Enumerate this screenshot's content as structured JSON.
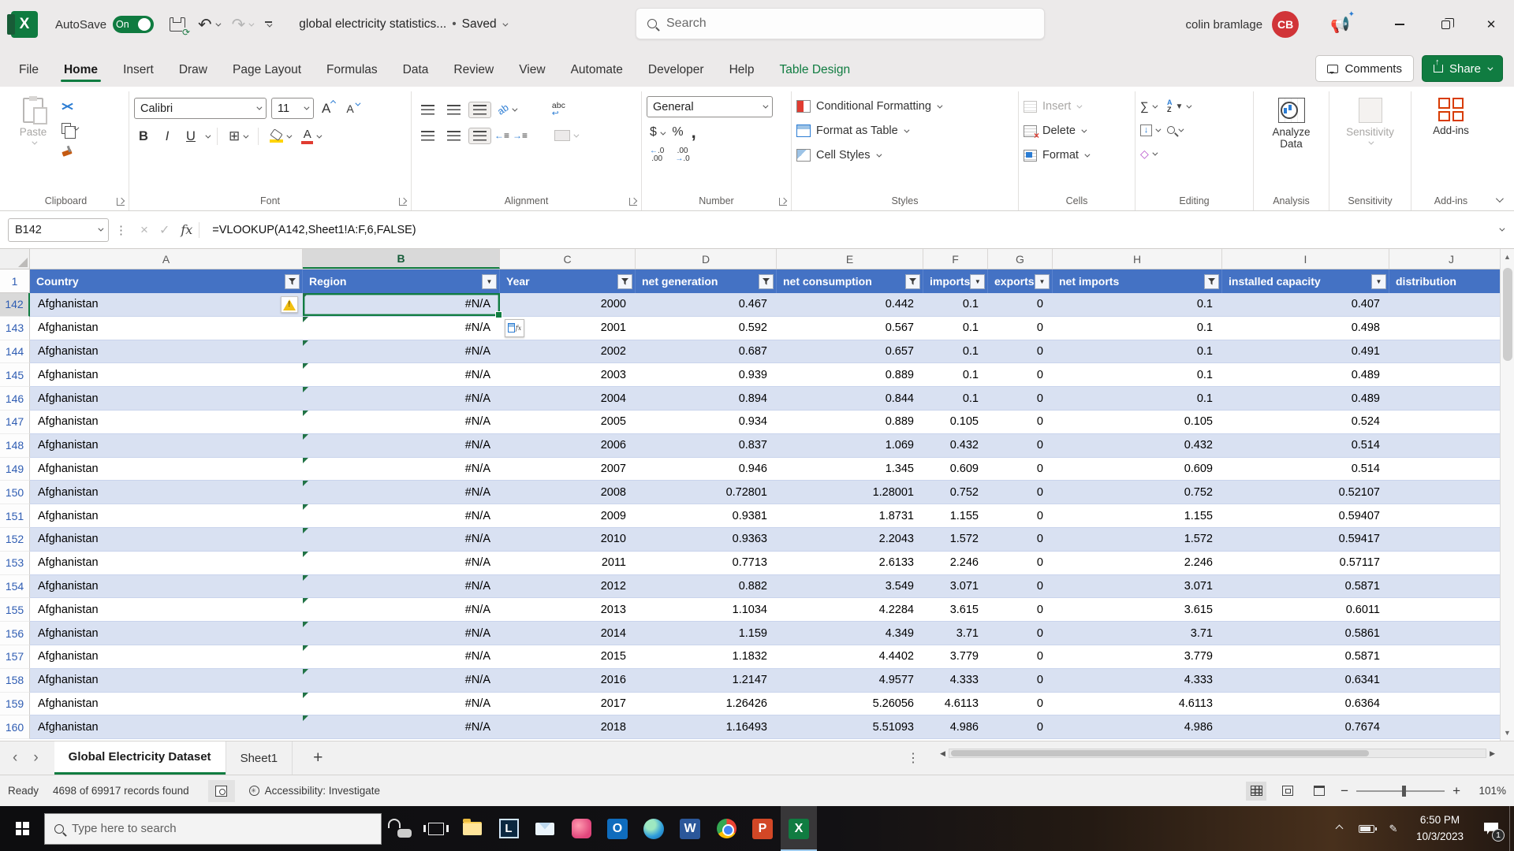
{
  "titlebar": {
    "autosave_label": "AutoSave",
    "autosave_state": "On",
    "filename": "global electricity statistics...",
    "doc_sep": "•",
    "saved_status": "Saved",
    "search_placeholder": "Search",
    "user_name": "colin bramlage",
    "user_initials": "CB"
  },
  "ribbon_tabs": {
    "items": [
      "File",
      "Home",
      "Insert",
      "Draw",
      "Page Layout",
      "Formulas",
      "Data",
      "Review",
      "View",
      "Automate",
      "Developer",
      "Help",
      "Table Design"
    ],
    "active": "Home",
    "contextual": "Table Design",
    "comments_label": "Comments",
    "share_label": "Share"
  },
  "ribbon": {
    "accent_green": "#107c41",
    "clipboard": {
      "paste": "Paste",
      "label": "Clipboard"
    },
    "font": {
      "font_name": "Calibri",
      "font_size": "11",
      "bold": "B",
      "italic": "I",
      "underline": "U",
      "grow": "A",
      "shrink": "A",
      "fontcolor_glyph": "A",
      "label": "Font"
    },
    "alignment": {
      "orient_glyph": "ab",
      "wrap_glyph": "abc",
      "label": "Alignment"
    },
    "number": {
      "format": "General",
      "dollar": "$",
      "percent": "%",
      "comma": ",",
      "dec_left": ".0→.00",
      "dec_right": ".00→.0",
      "label": "Number"
    },
    "styles": {
      "conditional": "Conditional Formatting",
      "format_table": "Format as Table",
      "cell_styles": "Cell Styles",
      "label": "Styles"
    },
    "cells": {
      "insert": "Insert",
      "delete": "Delete",
      "format": "Format",
      "label": "Cells"
    },
    "editing": {
      "sum_glyph": "∑",
      "clear_glyph": "◇",
      "az_a": "A",
      "az_z": "Z",
      "label": "Editing"
    },
    "analysis": {
      "button": "Analyze Data",
      "label": "Analysis"
    },
    "sensitivity": {
      "button": "Sensitivity",
      "label": "Sensitivity"
    },
    "addins": {
      "button": "Add-ins",
      "label": "Add-ins"
    }
  },
  "formula_bar": {
    "name_box": "B142",
    "cancel_glyph": "×",
    "enter_glyph": "✓",
    "fx_label": "fx",
    "formula": "=VLOOKUP(A142,Sheet1!A:F,6,FALSE)"
  },
  "grid": {
    "row1_label": "1",
    "col_letters": [
      "A",
      "B",
      "C",
      "D",
      "E",
      "F",
      "G",
      "H",
      "I",
      "J"
    ],
    "selected_col": "B",
    "selected_row": 142,
    "error_row": 143,
    "headers": [
      {
        "label": "Country",
        "filter": "funnel"
      },
      {
        "label": "Region",
        "filter": "menu"
      },
      {
        "label": "Year",
        "filter": "funnel"
      },
      {
        "label": "net generation",
        "filter": "funnel"
      },
      {
        "label": "net consumption",
        "filter": "funnel"
      },
      {
        "label": "imports",
        "filter": "menu"
      },
      {
        "label": "exports",
        "filter": "menu"
      },
      {
        "label": "net imports",
        "filter": "funnel"
      },
      {
        "label": "installed capacity",
        "filter": "menu"
      },
      {
        "label": "distribution",
        "filter": "none"
      }
    ],
    "rows": [
      [
        142,
        "Afghanistan",
        "#N/A",
        "2000",
        "0.467",
        "0.442",
        "0.1",
        "0",
        "0.1",
        "0.407"
      ],
      [
        143,
        "Afghanistan",
        "#N/A",
        "2001",
        "0.592",
        "0.567",
        "0.1",
        "0",
        "0.1",
        "0.498"
      ],
      [
        144,
        "Afghanistan",
        "#N/A",
        "2002",
        "0.687",
        "0.657",
        "0.1",
        "0",
        "0.1",
        "0.491"
      ],
      [
        145,
        "Afghanistan",
        "#N/A",
        "2003",
        "0.939",
        "0.889",
        "0.1",
        "0",
        "0.1",
        "0.489"
      ],
      [
        146,
        "Afghanistan",
        "#N/A",
        "2004",
        "0.894",
        "0.844",
        "0.1",
        "0",
        "0.1",
        "0.489"
      ],
      [
        147,
        "Afghanistan",
        "#N/A",
        "2005",
        "0.934",
        "0.889",
        "0.105",
        "0",
        "0.105",
        "0.524"
      ],
      [
        148,
        "Afghanistan",
        "#N/A",
        "2006",
        "0.837",
        "1.069",
        "0.432",
        "0",
        "0.432",
        "0.514"
      ],
      [
        149,
        "Afghanistan",
        "#N/A",
        "2007",
        "0.946",
        "1.345",
        "0.609",
        "0",
        "0.609",
        "0.514"
      ],
      [
        150,
        "Afghanistan",
        "#N/A",
        "2008",
        "0.72801",
        "1.28001",
        "0.752",
        "0",
        "0.752",
        "0.52107"
      ],
      [
        151,
        "Afghanistan",
        "#N/A",
        "2009",
        "0.9381",
        "1.8731",
        "1.155",
        "0",
        "1.155",
        "0.59407"
      ],
      [
        152,
        "Afghanistan",
        "#N/A",
        "2010",
        "0.9363",
        "2.2043",
        "1.572",
        "0",
        "1.572",
        "0.59417"
      ],
      [
        153,
        "Afghanistan",
        "#N/A",
        "2011",
        "0.7713",
        "2.6133",
        "2.246",
        "0",
        "2.246",
        "0.57117"
      ],
      [
        154,
        "Afghanistan",
        "#N/A",
        "2012",
        "0.882",
        "3.549",
        "3.071",
        "0",
        "3.071",
        "0.5871"
      ],
      [
        155,
        "Afghanistan",
        "#N/A",
        "2013",
        "1.1034",
        "4.2284",
        "3.615",
        "0",
        "3.615",
        "0.6011"
      ],
      [
        156,
        "Afghanistan",
        "#N/A",
        "2014",
        "1.159",
        "4.349",
        "3.71",
        "0",
        "3.71",
        "0.5861"
      ],
      [
        157,
        "Afghanistan",
        "#N/A",
        "2015",
        "1.1832",
        "4.4402",
        "3.779",
        "0",
        "3.779",
        "0.5871"
      ],
      [
        158,
        "Afghanistan",
        "#N/A",
        "2016",
        "1.2147",
        "4.9577",
        "4.333",
        "0",
        "4.333",
        "0.6341"
      ],
      [
        159,
        "Afghanistan",
        "#N/A",
        "2017",
        "1.26426",
        "5.26056",
        "4.6113",
        "0",
        "4.6113",
        "0.6364"
      ],
      [
        160,
        "Afghanistan",
        "#N/A",
        "2018",
        "1.16493",
        "5.51093",
        "4.986",
        "0",
        "4.986",
        "0.7674"
      ]
    ]
  },
  "sheet_tabs": {
    "active": "Global Electricity  Dataset",
    "other": "Sheet1",
    "add_glyph": "+",
    "prev_glyph": "‹",
    "next_glyph": "›",
    "kebab_glyph": "⋮"
  },
  "status_bar": {
    "ready": "Ready",
    "records": "4698 of 69917 records found",
    "accessibility": "Accessibility: Investigate",
    "zoom_out_glyph": "−",
    "zoom_in_glyph": "+",
    "zoom": "101%"
  },
  "taskbar": {
    "search_placeholder": "Type here to search",
    "apps": [
      {
        "kind": "periph",
        "name": "gaming-peripherals",
        "letter": ""
      },
      {
        "kind": "tview",
        "name": "task-view",
        "letter": ""
      },
      {
        "kind": "folder",
        "name": "file-explorer",
        "letter": ""
      },
      {
        "kind": "lapp",
        "name": "l-app",
        "letter": "L"
      },
      {
        "kind": "mail",
        "name": "mail",
        "letter": ""
      },
      {
        "kind": "pinkapp",
        "name": "pink-app",
        "letter": ""
      },
      {
        "kind": "outlook",
        "name": "outlook",
        "letter": "O"
      },
      {
        "kind": "globe",
        "name": "browser-globe",
        "letter": ""
      },
      {
        "kind": "wordt",
        "name": "word",
        "letter": "W"
      },
      {
        "kind": "chrome",
        "name": "chrome",
        "letter": ""
      },
      {
        "kind": "pptt",
        "name": "powerpoint",
        "letter": "P"
      },
      {
        "kind": "excelt",
        "name": "excel",
        "letter": "X",
        "active": true
      }
    ],
    "time": "6:50 PM",
    "date": "10/3/2023",
    "notification_count": "1"
  }
}
